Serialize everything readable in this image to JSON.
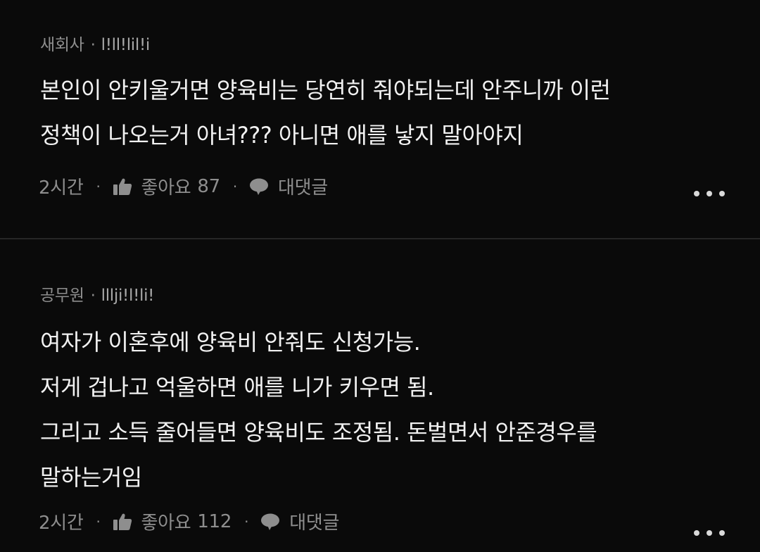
{
  "comments": [
    {
      "author": "새회사",
      "separator": "·",
      "user_id": "l!ll!lil!i",
      "lines": [
        "본인이 안키울거면 양육비는 당연히 줘야되는데 안주니까 이런",
        "정책이 나오는거 아녀??? 아니면 애를 낳지 말아야지"
      ],
      "time": "2시간",
      "like_label": "좋아요",
      "like_count": "87",
      "reply_label": "대댓글",
      "like_icon": "thumbs-up-icon",
      "reply_icon": "speech-bubble-icon",
      "more_icon": "more-options-icon"
    },
    {
      "author": "공무원",
      "separator": "·",
      "user_id": "lllji!l!li!",
      "lines": [
        "여자가 이혼후에 양육비 안줘도 신청가능.",
        "저게 겁나고 억울하면 애를 니가 키우면 됨.",
        "그리고 소득 줄어들면 양육비도 조정됨. 돈벌면서 안준경우를",
        "말하는거임"
      ],
      "time": "2시간",
      "like_label": "좋아요",
      "like_count": "112",
      "reply_label": "대댓글",
      "like_icon": "thumbs-up-icon",
      "reply_icon": "speech-bubble-icon",
      "more_icon": "more-options-icon"
    }
  ],
  "meta_separator": "·",
  "colors": {
    "background": "#0a0a0a",
    "text": "#f1f1f1",
    "muted": "#8e8e8e",
    "divider": "#262626"
  }
}
